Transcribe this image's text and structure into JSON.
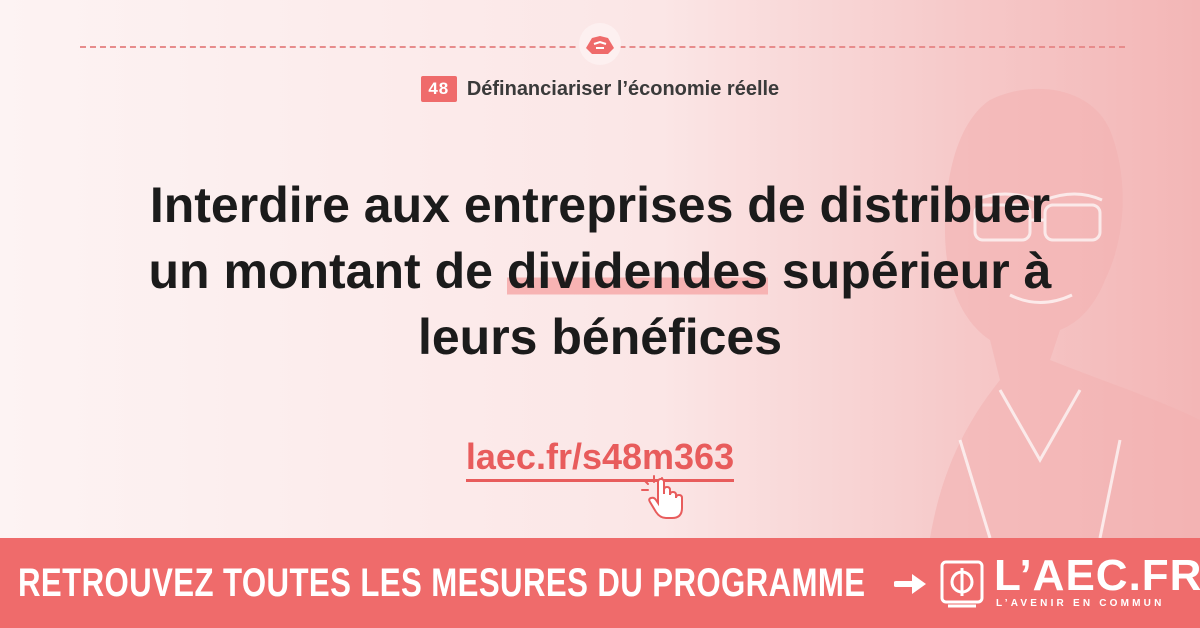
{
  "section": {
    "number": "48",
    "title": "Définanciariser l’économie réelle"
  },
  "headline": {
    "line1": "Interdire aux entreprises de distribuer",
    "line2_before": "un montant de ",
    "line2_highlight": "dividendes",
    "line2_after": " supérieur à",
    "line3": "leurs bénéfices"
  },
  "link": {
    "text": "laec.fr/s48m363"
  },
  "footer": {
    "cta": "RETROUVEZ TOUTES LES MESURES DU PROGRAMME",
    "logo_text": "L’AEC.FR",
    "logo_tagline": "L’AVENIR EN COMMUN"
  },
  "colors": {
    "accent": "#ef6b6b",
    "link": "#e85c5c",
    "highlight": "#f7b3b3",
    "text": "#1b1b1b"
  },
  "icons": [
    "handshake-icon",
    "pointer-hand-icon",
    "arrow-right-icon",
    "phi-logo-icon"
  ]
}
